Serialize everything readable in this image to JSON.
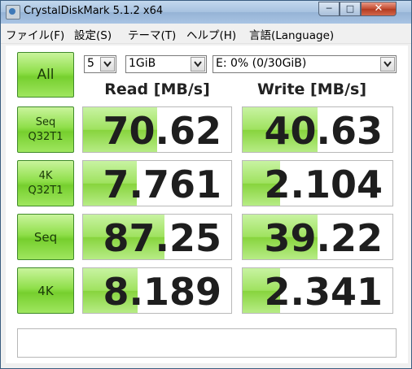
{
  "window": {
    "title": "CrystalDiskMark 5.1.2 x64",
    "minimize": "─",
    "maximize": "□",
    "close": "✕"
  },
  "menu": [
    "ファイル(F)",
    "設定(S)",
    "テーマ(T)",
    "ヘルプ(H)",
    "言語(Language)"
  ],
  "controls": {
    "all_label": "All",
    "count": "5",
    "size": "1GiB",
    "drive": "E: 0% (0/30GiB)"
  },
  "columns": {
    "read": "Read [MB/s]",
    "write": "Write [MB/s]"
  },
  "tests": [
    {
      "line1": "Seq",
      "line2": "Q32T1",
      "read": "70.62",
      "write": "40.63",
      "read_bar": 0.5,
      "write_bar": 0.5
    },
    {
      "line1": "4K",
      "line2": "Q32T1",
      "read": "7.761",
      "write": "2.104",
      "read_bar": 0.36,
      "write_bar": 0.25
    },
    {
      "line1": "Seq",
      "line2": "",
      "read": "87.25",
      "write": "39.22",
      "read_bar": 0.55,
      "write_bar": 0.5
    },
    {
      "line1": "4K",
      "line2": "",
      "read": "8.189",
      "write": "2.341",
      "read_bar": 0.37,
      "write_bar": 0.25
    }
  ],
  "comment": "",
  "colors": {
    "accent_green": "#8fdf4a",
    "bar_green": "#9fe25f",
    "title_bar": "#a7c2e0",
    "close_red": "#c24a2f"
  }
}
